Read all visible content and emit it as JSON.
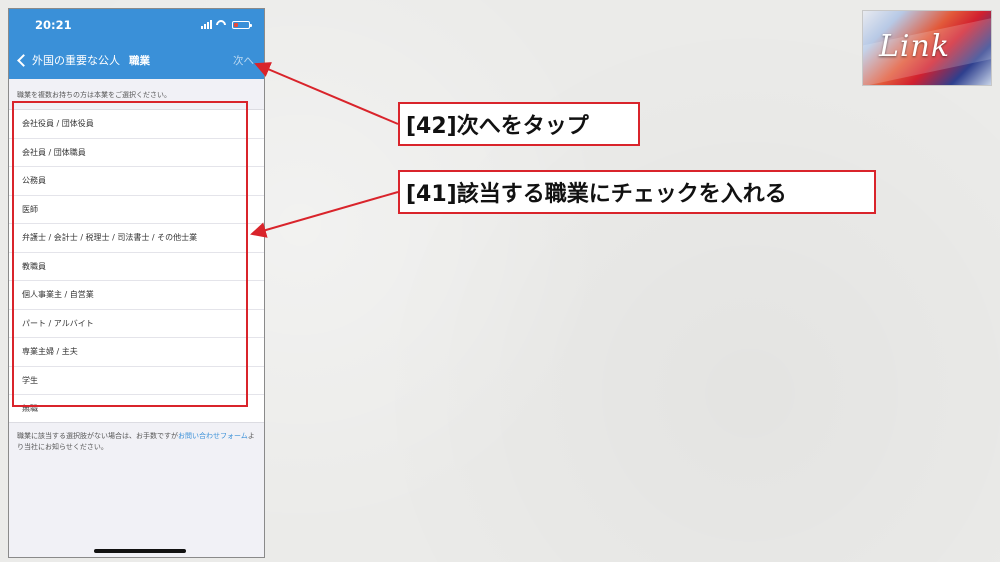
{
  "phone": {
    "status": {
      "time": "20:21"
    },
    "nav": {
      "back_label": "外国の重要な公人",
      "title": "職業",
      "next_label": "次へ"
    },
    "instruction": "職業を複数お持ちの方は本業をご選択ください。",
    "occupations": [
      "会社役員 / 団体役員",
      "会社員 / 団体職員",
      "公務員",
      "医師",
      "弁護士 / 会計士 / 税理士 / 司法書士 / その他士業",
      "教職員",
      "個人事業主 / 自営業",
      "パート / アルバイト",
      "専業主婦 / 主夫",
      "学生",
      "無職"
    ],
    "footer": {
      "prefix": "職業に該当する選択肢がない場合は、お手数ですが",
      "link": "お問い合わせフォーム",
      "suffix": "より当社にお知らせください。"
    }
  },
  "annotations": {
    "step42": "[42]次へをタップ",
    "step41": "[41]該当する職業にチェックを入れる"
  },
  "logo": {
    "text": "Link"
  },
  "colors": {
    "accent": "#3a90d8",
    "annotation": "#d9242b"
  }
}
